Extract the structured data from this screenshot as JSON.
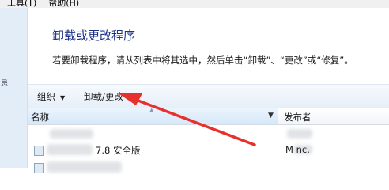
{
  "menubar": {
    "items": [
      "工具(T)",
      "帮助(H)"
    ]
  },
  "nav": {
    "glyph": "忌"
  },
  "page": {
    "title": "卸载或更改程序",
    "description": "若要卸载程序，请从列表中将其选中，然后单击“卸载”、“更改”或“修复”。"
  },
  "toolbar": {
    "organize_label": "组织",
    "organize_arrow": "▼",
    "uninstall_change_label": "卸载/更改"
  },
  "list": {
    "columns": {
      "name": "名称",
      "publisher": "发布者"
    },
    "rows": [
      {
        "name": "",
        "publisher": ""
      },
      {
        "name": "7.8 安全版",
        "publisher": "M    nc."
      },
      {
        "name": "",
        "publisher": ""
      }
    ]
  },
  "colors": {
    "title": "#1e3287",
    "annotation_arrow": "#e8312c",
    "toolbar_bg": "#e6eef8"
  }
}
